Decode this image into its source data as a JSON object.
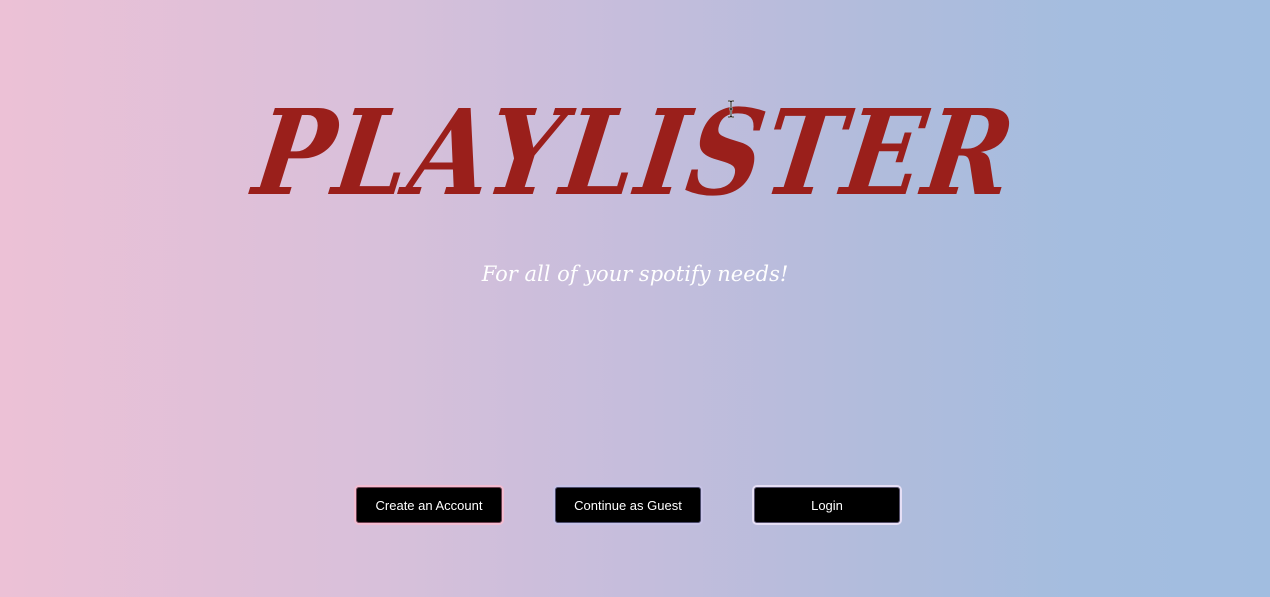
{
  "app": {
    "title": "PLAYLISTER",
    "tagline": "For all of your spotify needs!"
  },
  "buttons": {
    "create_account": "Create an Account",
    "continue_guest": "Continue as Guest",
    "login": "Login"
  },
  "colors": {
    "title": "#9a1f1b",
    "tagline": "#ffffff",
    "button_bg": "#000000",
    "gradient_left": "#ecc1d6",
    "gradient_right": "#a1bde0"
  },
  "icons": {
    "cursor": "text-cursor-icon"
  }
}
